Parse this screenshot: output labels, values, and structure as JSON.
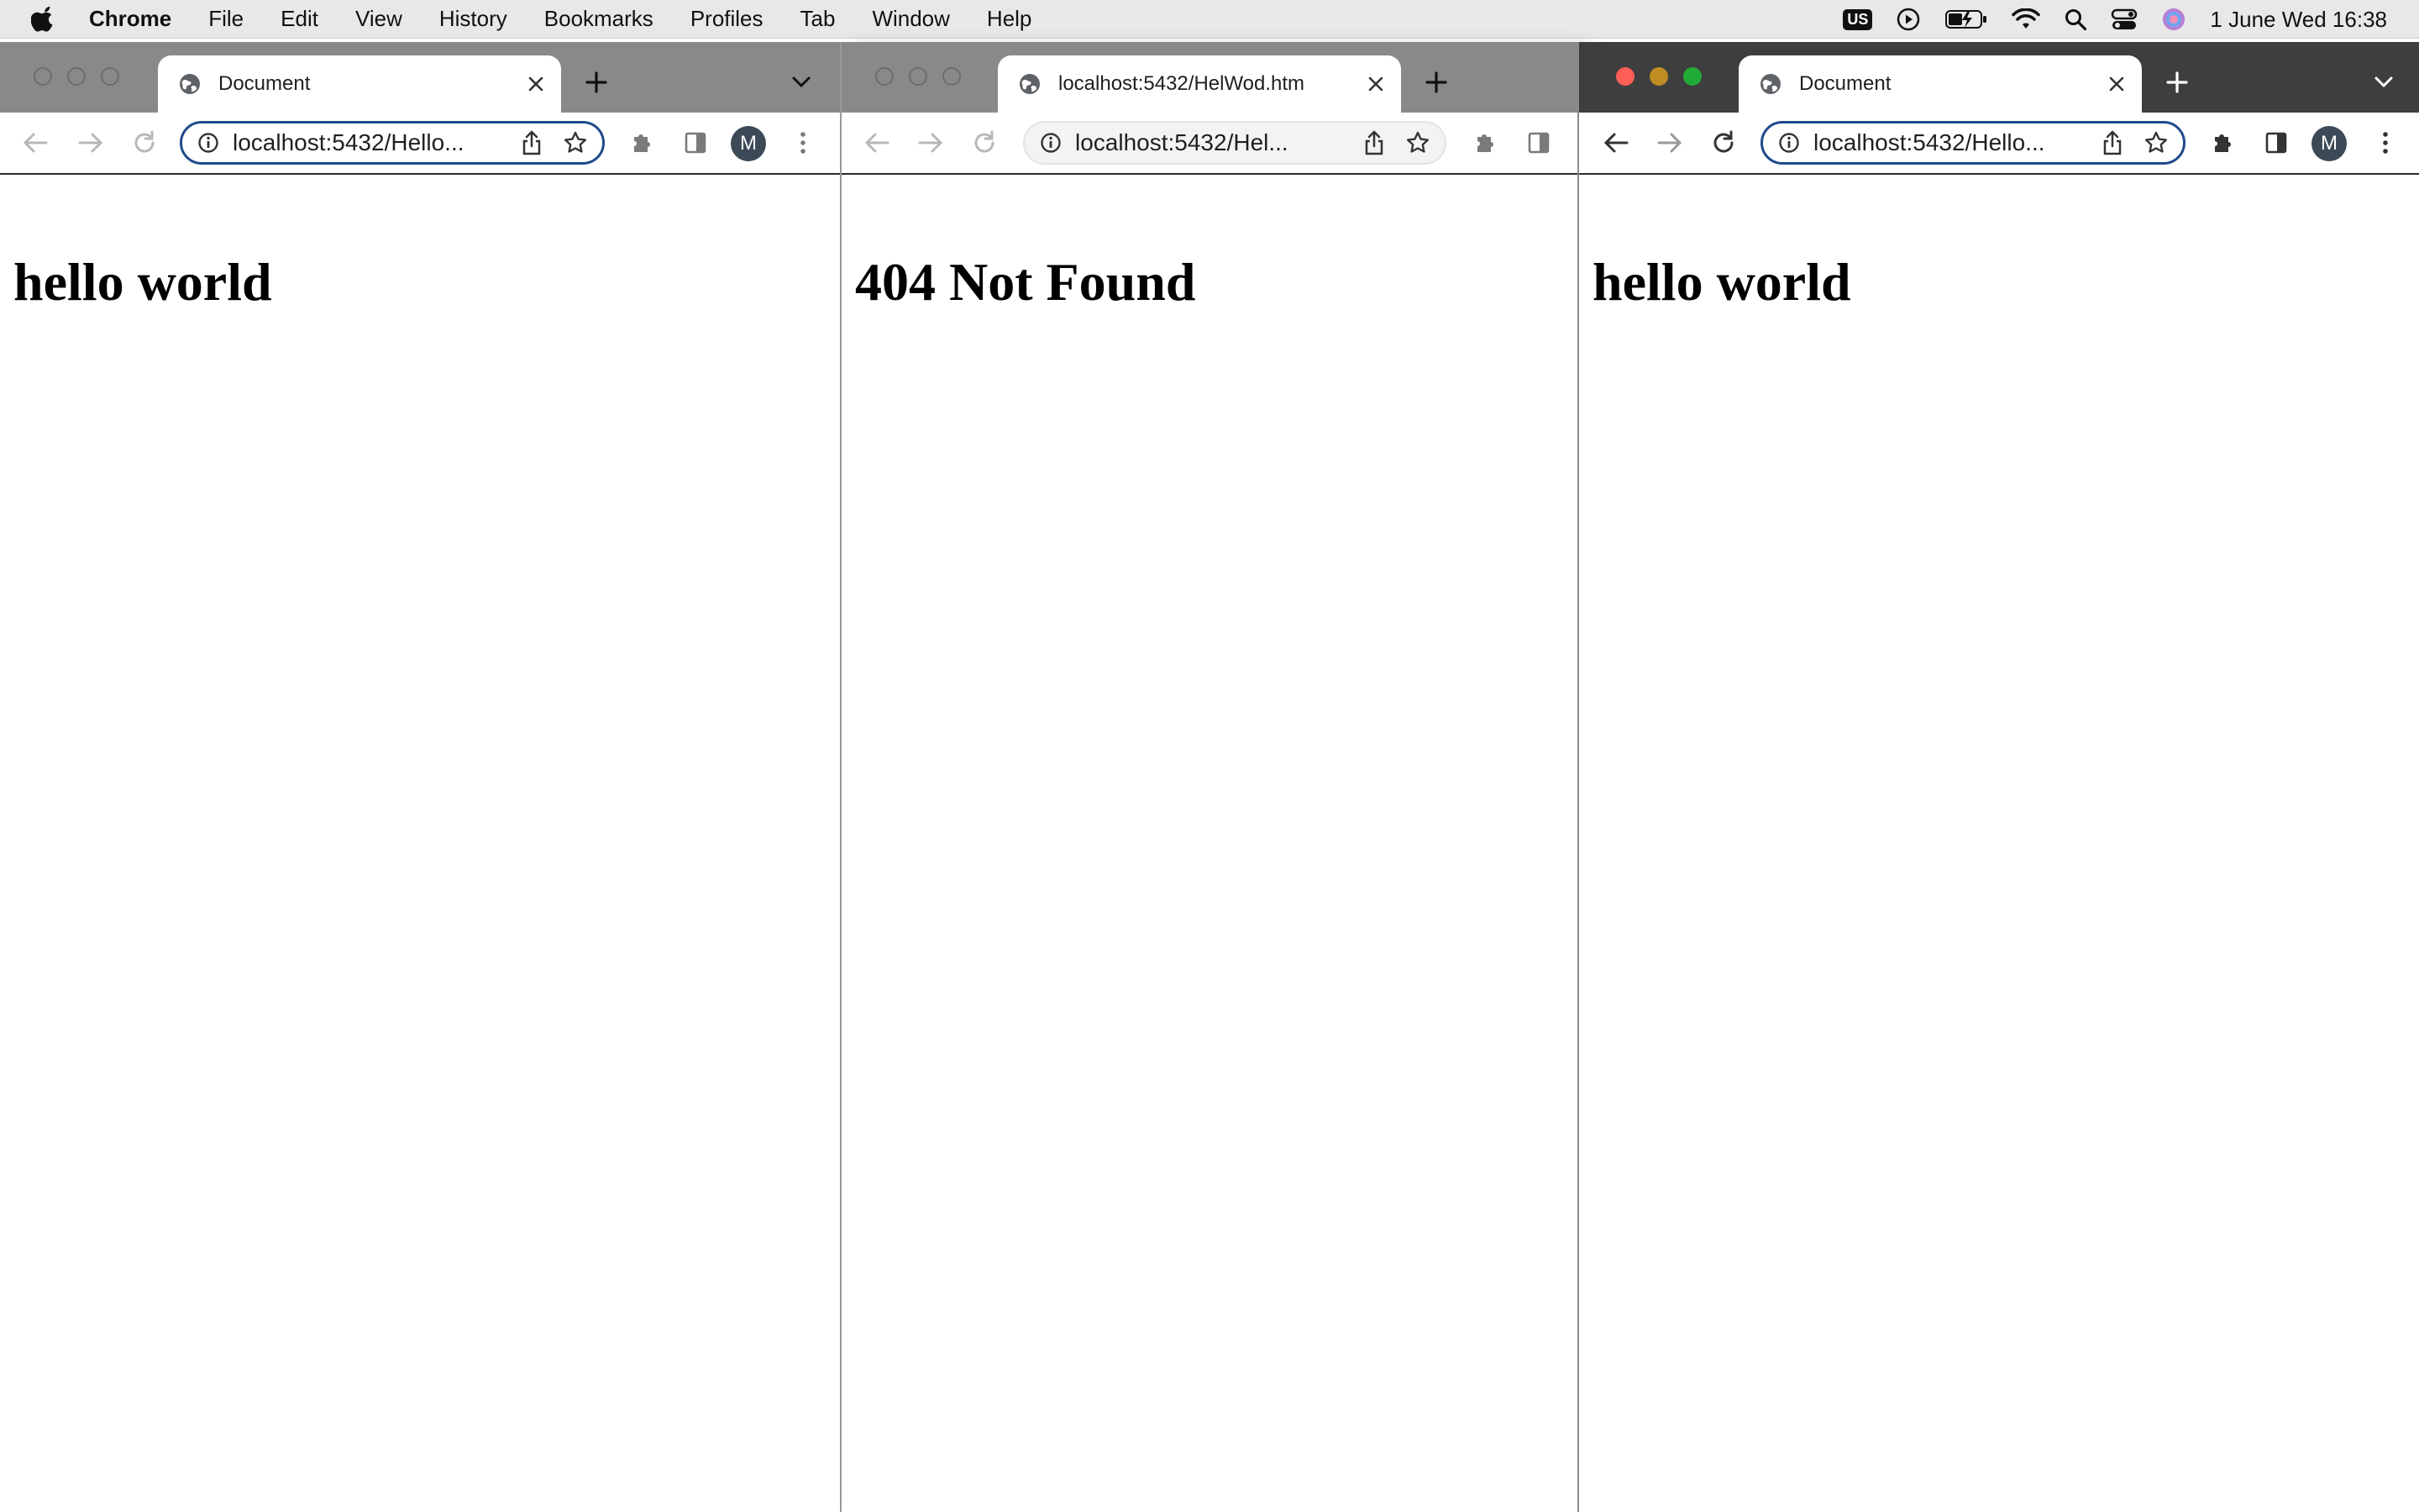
{
  "menubar": {
    "app_name": "Chrome",
    "items": [
      "File",
      "Edit",
      "View",
      "History",
      "Bookmarks",
      "Profiles",
      "Tab",
      "Window",
      "Help"
    ],
    "keyboard_layout": "US",
    "clock": "1 June Wed  16:38"
  },
  "windows": [
    {
      "tab_title": "Document",
      "url": "localhost:5432/Hello...",
      "page_heading": "hello world",
      "profile_initial": "M",
      "active": false
    },
    {
      "tab_title": "localhost:5432/HelWod.htm",
      "url": "localhost:5432/Hel...",
      "page_heading": "404 Not Found",
      "active": false
    },
    {
      "tab_title": "Document",
      "url": "localhost:5432/Hello...",
      "page_heading": "hello world",
      "profile_initial": "M",
      "active": true
    }
  ],
  "colors": {
    "traffic_close": "#ff5f57",
    "traffic_minimize": "#febc2e",
    "traffic_zoom": "#28c840",
    "omnibox_focus": "#1f4a8c"
  },
  "icons": {
    "menubar": [
      "apple-icon",
      "keyboard-layout-icon",
      "play-icon",
      "battery-icon",
      "wifi-icon",
      "spotlight-search-icon",
      "control-center-icon",
      "siri-icon"
    ],
    "toolbar": [
      "back-icon",
      "forward-icon",
      "reload-icon",
      "site-info-icon",
      "share-icon",
      "bookmark-star-icon",
      "extensions-icon",
      "side-panel-icon",
      "profile-avatar",
      "more-menu-icon"
    ]
  }
}
